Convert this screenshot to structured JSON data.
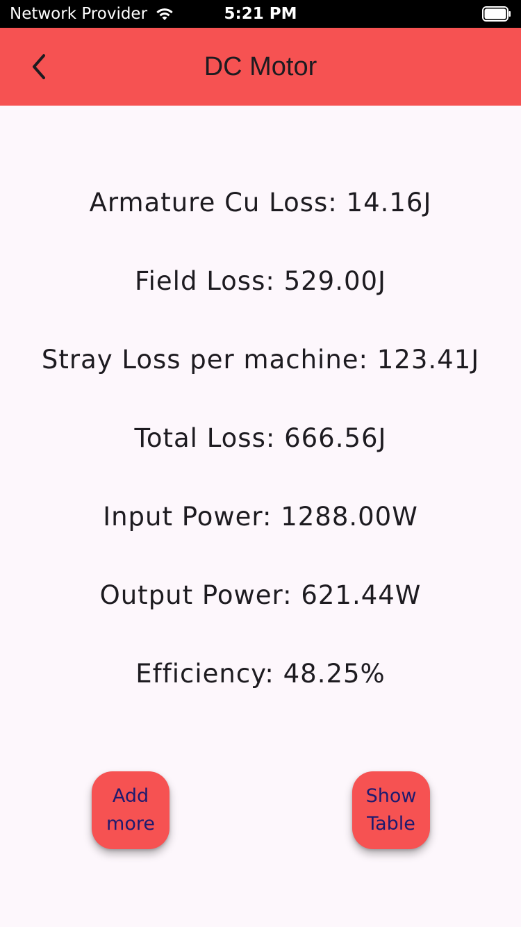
{
  "status_bar": {
    "carrier": "Network Provider",
    "time": "5:21 PM",
    "wifi_icon": "wifi-icon",
    "battery_icon": "battery-icon"
  },
  "app_bar": {
    "title": "DC Motor",
    "back_icon": "chevron-left-icon",
    "background": "#f65252"
  },
  "results": [
    "Armature Cu Loss: 14.16J",
    "Field Loss: 529.00J",
    "Stray Loss per machine: 123.41J",
    "Total Loss: 666.56J",
    "Input Power: 1288.00W",
    "Output Power: 621.44W",
    "Efficiency: 48.25%"
  ],
  "buttons": {
    "add_more": {
      "line1": "Add",
      "line2": "more"
    },
    "show_table": {
      "line1": "Show",
      "line2": "Table"
    }
  },
  "colors": {
    "accent": "#f65252",
    "button_text": "#1e1a6e",
    "background": "#fdf7fc"
  }
}
